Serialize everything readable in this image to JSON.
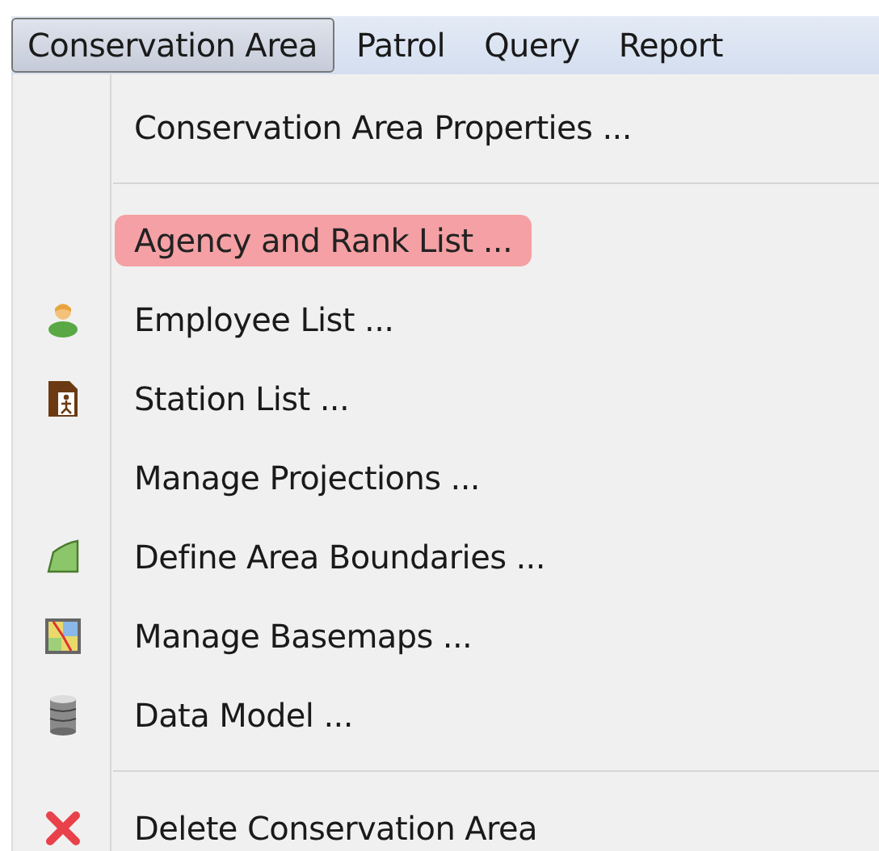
{
  "menu_bar": [
    {
      "label": "Conservation Area",
      "selected": true
    },
    {
      "label": "Patrol",
      "selected": false
    },
    {
      "label": "Query",
      "selected": false
    },
    {
      "label": "Report",
      "selected": false
    }
  ],
  "menu_items": [
    {
      "kind": "item",
      "label": "Conservation Area Properties ...",
      "selected": false
    },
    {
      "kind": "separator"
    },
    {
      "kind": "item",
      "label": "Agency and Rank List ...",
      "selected": true
    },
    {
      "kind": "item",
      "label": "Employee List ...",
      "selected": false
    },
    {
      "kind": "item",
      "label": "Station List ...",
      "selected": false
    },
    {
      "kind": "item",
      "label": "Manage Projections ...",
      "selected": false
    },
    {
      "kind": "item",
      "label": "Define Area Boundaries ...",
      "selected": false
    },
    {
      "kind": "item",
      "label": "Manage Basemaps ...",
      "selected": false
    },
    {
      "kind": "item",
      "label": "Data Model ...",
      "selected": false
    },
    {
      "kind": "separator"
    },
    {
      "kind": "item",
      "label": "Delete Conservation Area",
      "selected": false
    }
  ]
}
